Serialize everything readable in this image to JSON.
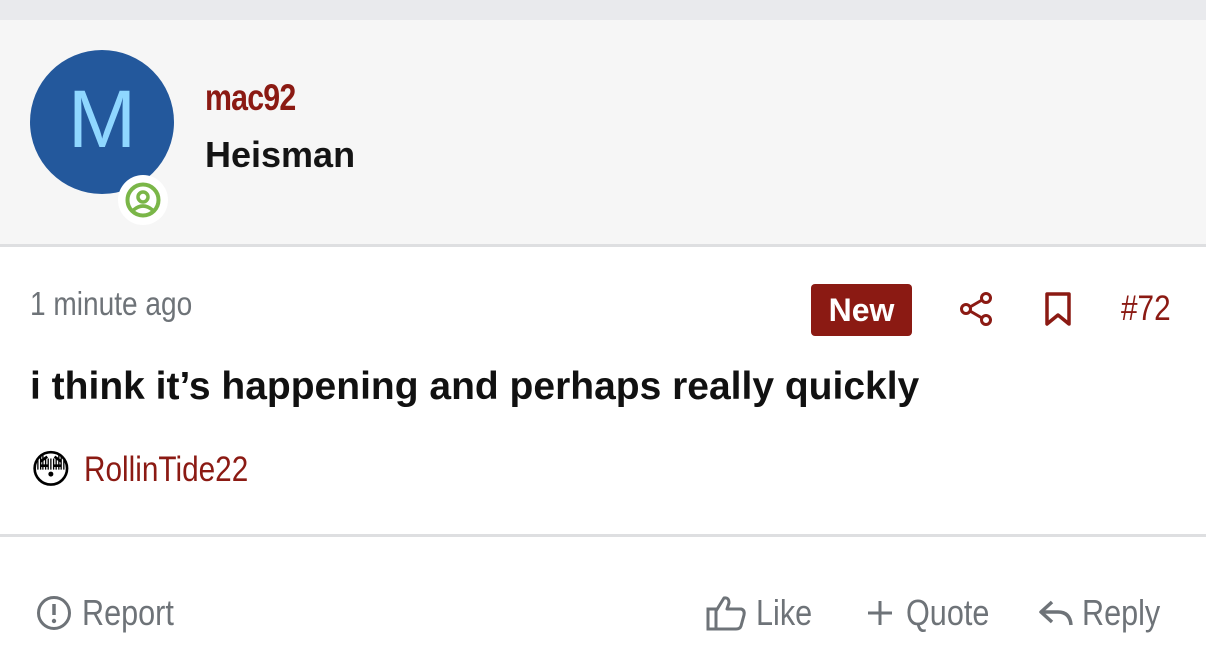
{
  "user": {
    "avatar_letter": "M",
    "username": "mac92",
    "title": "Heisman",
    "online_icon": "user-circle-icon"
  },
  "post": {
    "time": "1 minute ago",
    "badge": "New",
    "number": "#72",
    "message": "i think it’s happening and perhaps really quickly",
    "reaction": {
      "emoji": "😳",
      "user": "RollinTide22"
    }
  },
  "actions": {
    "report": "Report",
    "like": "Like",
    "quote": "Quote",
    "reply": "Reply"
  },
  "colors": {
    "brand": "#8b1a13",
    "avatar_bg": "#23589c",
    "avatar_letter": "#8fd7ff",
    "online": "#7ab648",
    "muted": "#6e7378"
  }
}
